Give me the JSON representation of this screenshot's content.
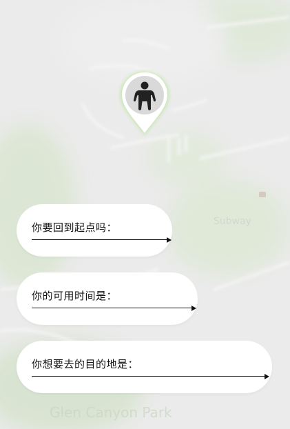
{
  "prompts": [
    {
      "label": "你要回到起点吗：",
      "value": ""
    },
    {
      "label": "你的可用时间是：",
      "value": ""
    },
    {
      "label": "你想要去的目的地是：",
      "value": ""
    }
  ],
  "map": {
    "label_1": "Subway",
    "label_2": "Glen Canyon Park"
  },
  "colors": {
    "pin_glow": "#b9e39a",
    "pin_body": "#ffffff",
    "pin_inner": "#d9d9d9",
    "icon": "#222222"
  },
  "icons": [
    "map-pin-icon",
    "person-icon",
    "arrow-right-icon"
  ]
}
